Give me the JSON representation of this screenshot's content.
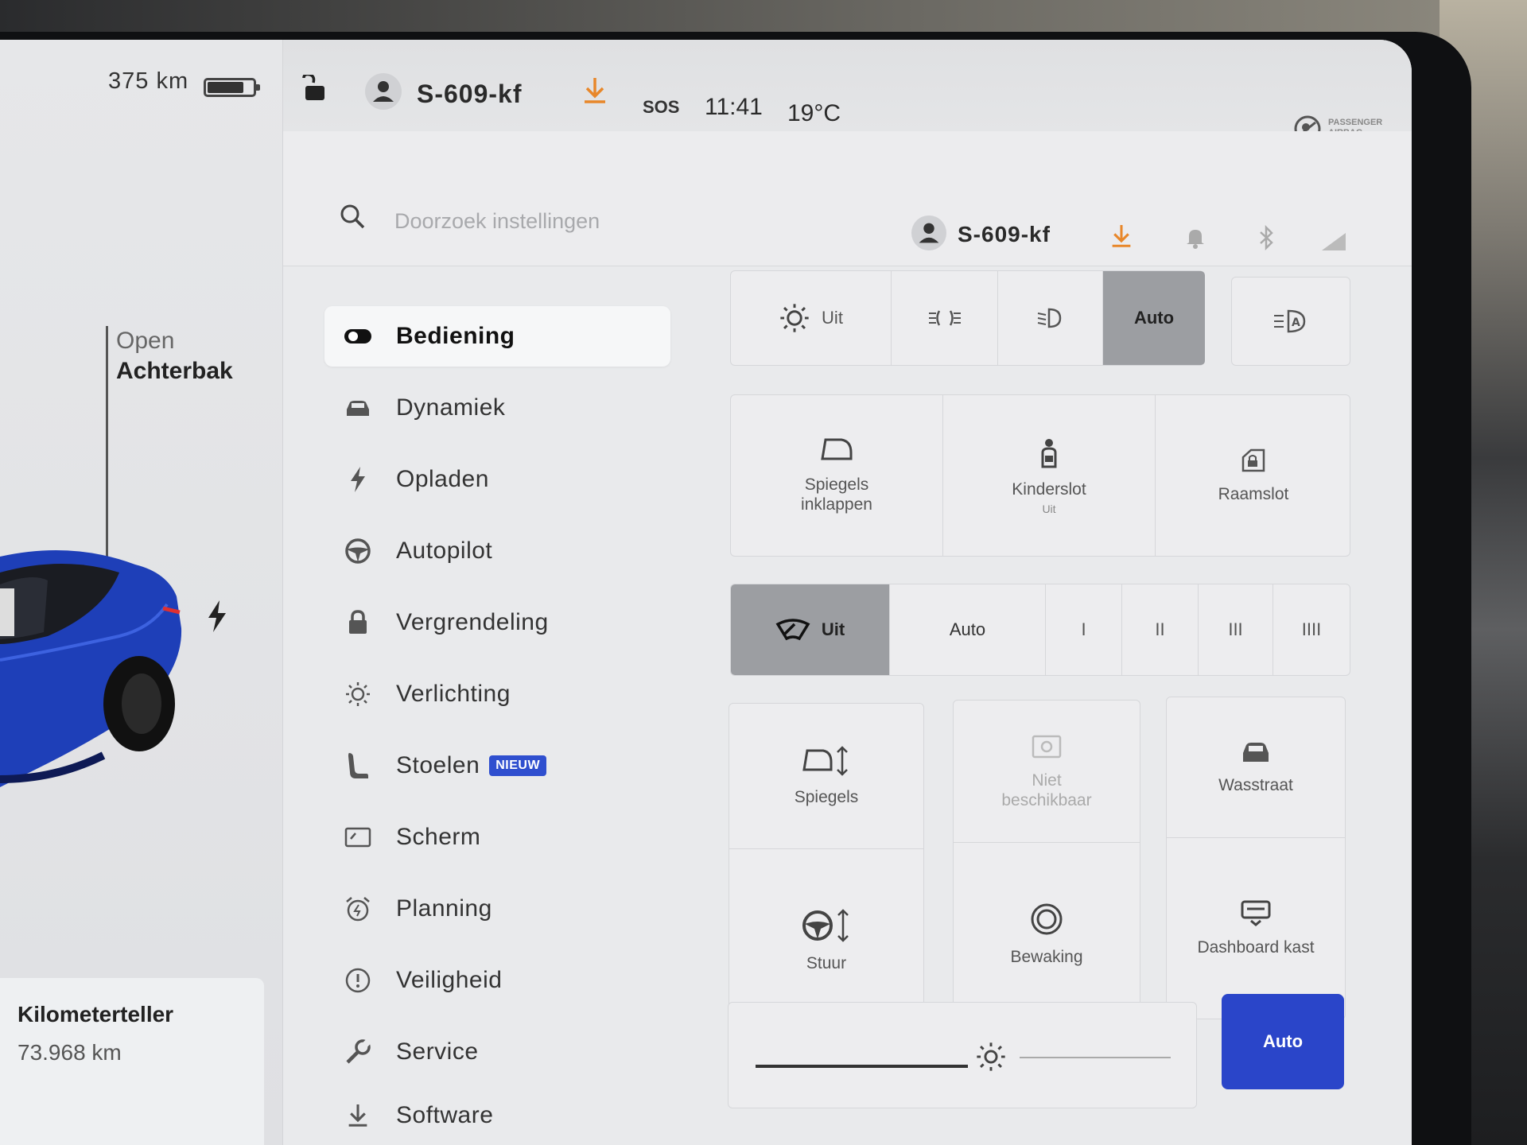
{
  "car_panel": {
    "range": "375 km",
    "battery_level": 0.8,
    "trunk_label_1": "Open",
    "trunk_label_2": "Achterbak",
    "odometer_title": "Kilometerteller",
    "odometer_value": "73.968 km"
  },
  "status_bar": {
    "profile_name": "S-609-kf",
    "sos": "SOS",
    "time": "11:41",
    "temperature": "19°C",
    "airbag_text_1": "PASSENGER",
    "airbag_text_2": "AIRBAG"
  },
  "search": {
    "placeholder": "Doorzoek instellingen",
    "profile_name": "S-609-kf"
  },
  "menu": {
    "items": [
      {
        "label": "Bediening",
        "icon": "toggle-icon",
        "active": true
      },
      {
        "label": "Dynamiek",
        "icon": "car-icon"
      },
      {
        "label": "Opladen",
        "icon": "bolt-icon"
      },
      {
        "label": "Autopilot",
        "icon": "steering-wheel-icon"
      },
      {
        "label": "Vergrendeling",
        "icon": "lock-icon"
      },
      {
        "label": "Verlichting",
        "icon": "sun-icon"
      },
      {
        "label": "Stoelen",
        "icon": "seat-icon",
        "badge": "NIEUW"
      },
      {
        "label": "Scherm",
        "icon": "display-icon"
      },
      {
        "label": "Planning",
        "icon": "alarm-clock-icon"
      },
      {
        "label": "Veiligheid",
        "icon": "alert-circle-icon"
      },
      {
        "label": "Service",
        "icon": "wrench-icon"
      },
      {
        "label": "Software",
        "icon": "download-icon"
      }
    ]
  },
  "controls": {
    "lights": {
      "options": [
        "Uit",
        "",
        "",
        "Auto"
      ],
      "selected": "Auto"
    },
    "mirrors_fold": "Spiegels inklappen",
    "child_lock": "Kinderslot",
    "child_lock_state": "Uit",
    "window_lock": "Raamslot",
    "wipers": {
      "options": [
        "Uit",
        "Auto",
        "I",
        "II",
        "III",
        "IIII"
      ],
      "selected": "Uit"
    },
    "mirrors": "Spiegels",
    "unavailable": "Niet beschikbaar",
    "car_wash": "Wasstraat",
    "steering": "Stuur",
    "sentry": "Bewaking",
    "glovebox": "Dashboard kast",
    "brightness_level": 0.58,
    "brightness_auto": "Auto"
  },
  "colors": {
    "accent_blue": "#2a45c9",
    "download_orange": "#e8872a",
    "selected_gray": "#9c9ea2",
    "car_blue": "#1e3fb8"
  }
}
